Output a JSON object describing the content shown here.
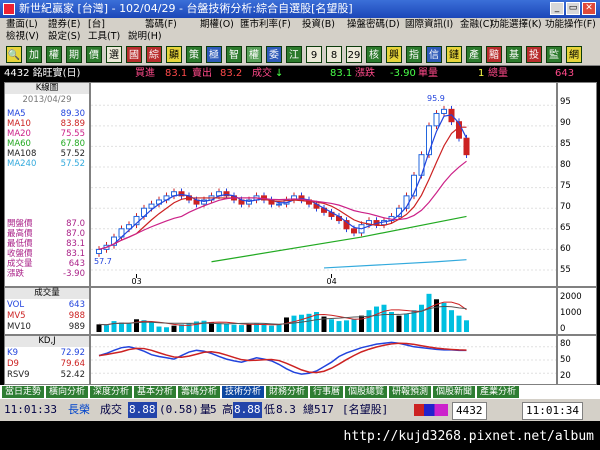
{
  "title": {
    "app": "新世紀贏家 [台灣]",
    "date": "102/04/29",
    "window": "台盤技術分析:綜合自選股[名望股]",
    "buttons": [
      "_",
      "▭",
      "✕"
    ]
  },
  "menu": {
    "row1": [
      "畫面(L)",
      "證券(E)",
      "[台]",
      "籌碼(F)",
      "期權(O)",
      "匯市利率(F)",
      "投資(B)",
      "操盤密碼(D)",
      "國際資訊(I)",
      "金融(C)",
      "功能選擇(K)",
      "功能操作(F)"
    ],
    "row2": [
      "檢視(V)",
      "設定(S)",
      "工具(T)",
      "說明(H)"
    ]
  },
  "toolbar": [
    {
      "t": "🔍",
      "c": "y"
    },
    {
      "t": "加",
      "c": ""
    },
    {
      "t": "權",
      "c": ""
    },
    {
      "t": "期",
      "c": ""
    },
    {
      "t": "價",
      "c": ""
    },
    {
      "t": "選",
      "c": "w"
    },
    {
      "t": "國",
      "c": "r"
    },
    {
      "t": "綜",
      "c": "r"
    },
    {
      "t": "顯",
      "c": "y"
    },
    {
      "t": "策",
      "c": ""
    },
    {
      "t": "極",
      "c": "b"
    },
    {
      "t": "智",
      "c": ""
    },
    {
      "t": "權",
      "c": "g"
    },
    {
      "t": "委",
      "c": "b"
    },
    {
      "t": "江",
      "c": ""
    },
    {
      "t": "9",
      "c": "w"
    },
    {
      "t": "8",
      "c": "w"
    },
    {
      "t": "29",
      "c": "w"
    },
    {
      "t": "核",
      "c": ""
    },
    {
      "t": "興",
      "c": "y"
    },
    {
      "t": "指",
      "c": ""
    },
    {
      "t": "信",
      "c": "b"
    },
    {
      "t": "鏈",
      "c": "y"
    },
    {
      "t": "產",
      "c": ""
    },
    {
      "t": "黯",
      "c": "r"
    },
    {
      "t": "基",
      "c": ""
    },
    {
      "t": "投",
      "c": "r"
    },
    {
      "t": "監",
      "c": ""
    },
    {
      "t": "網",
      "c": "y"
    }
  ],
  "quote": {
    "code": "4432 銘旺實(日)",
    "buy_label": "買進",
    "buy": "83.1",
    "sell_label": "賣出",
    "sell": "83.2",
    "deal_label": "成交",
    "deal_arrow": "↓",
    "deal": "83.1",
    "chg_label": "漲跌",
    "chg": "-3.90",
    "vol_label": "單量",
    "vol": "1",
    "total_label": "總量",
    "total": "643"
  },
  "kpanel": {
    "title": "K線圖",
    "date": "2013/04/29",
    "ma": [
      {
        "name": "MA5",
        "val": "89.30",
        "color": "#2244dd"
      },
      {
        "name": "MA10",
        "val": "83.89",
        "color": "#cc2222"
      },
      {
        "name": "MA20",
        "val": "75.55",
        "color": "#cc2288"
      },
      {
        "name": "MA60",
        "val": "67.80",
        "color": "#22aa22"
      },
      {
        "name": "MA108",
        "val": "57.52",
        "color": "#222222"
      },
      {
        "name": "MA240",
        "val": "57.52",
        "color": "#33aadd"
      }
    ],
    "ohlc": [
      {
        "name": "開盤價",
        "val": "87.0"
      },
      {
        "name": "最高價",
        "val": "87.0"
      },
      {
        "name": "最低價",
        "val": "83.1"
      },
      {
        "name": "收盤價",
        "val": "83.1"
      },
      {
        "name": "成交量",
        "val": "643"
      },
      {
        "name": "漲跌",
        "val": "-3.90"
      }
    ],
    "high_mark": "95.9",
    "low_mark": "57.7",
    "yticks": [
      "95",
      "90",
      "85",
      "80",
      "75",
      "70",
      "65",
      "60",
      "55"
    ],
    "xticks": [
      "03",
      "04"
    ]
  },
  "volpanel": {
    "title": "成交量",
    "rows": [
      {
        "name": "VOL",
        "val": "643",
        "color": "#2244dd"
      },
      {
        "name": "MV5",
        "val": "988",
        "color": "#cc2222"
      },
      {
        "name": "MV10",
        "val": "989",
        "color": "#222222"
      }
    ],
    "yticks": [
      "2000",
      "1000",
      "0"
    ]
  },
  "kdpanel": {
    "title": "KD,J",
    "rows": [
      {
        "name": "K9",
        "val": "72.92",
        "color": "#2244dd"
      },
      {
        "name": "D9",
        "val": "79.64",
        "color": "#cc2222"
      },
      {
        "name": "RSV9",
        "val": "52.42",
        "color": "#222222"
      }
    ],
    "yticks": [
      "80",
      "50",
      "20"
    ]
  },
  "tabs": [
    "當日走勢",
    "橫向分析",
    "深度分析",
    "基本分析",
    "籌碼分析",
    "技術分析",
    "財務分析",
    "行事曆",
    "個股總覽",
    "研報預測",
    "個股新聞",
    "產業分析"
  ],
  "active_tab": "技術分析",
  "status": {
    "time": "11:01:33",
    "name": "長榮",
    "deal_label": "成交",
    "deal": "8.88",
    "chg": "(0.58)",
    "vol_label": "量",
    "vol": "5",
    "high_label": "高",
    "high": "8.88",
    "low_label": "低",
    "low": "8.3",
    "total_label": "總",
    "total": "517",
    "group": "[名望股]",
    "code": "4432",
    "clock": "11:01:34"
  },
  "watermark_url": "http://kujd3268.pixnet.net/album"
}
